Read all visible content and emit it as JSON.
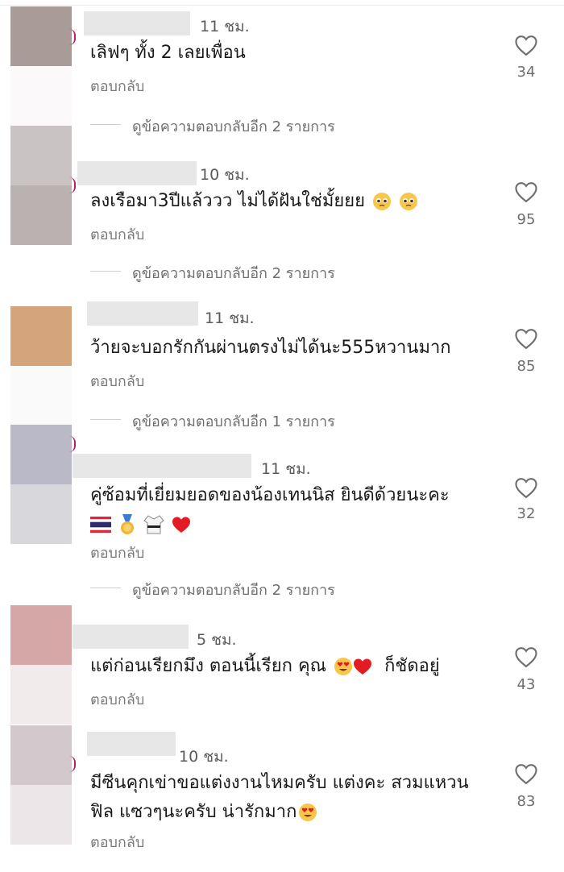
{
  "comments": [
    {
      "time": "11 ชม.",
      "text": "เลิฟๆ ทั้ง 2 เลยเพื่อน",
      "reply_label": "ตอบกลับ",
      "likes": "34",
      "more_replies": "ดูข้อความตอบกลับอีก 2 รายการ"
    },
    {
      "time": "10 ชม.",
      "text": "ลงเรือมา3ปีแล้ววว ไม่ได้ฝันใช่มั้ยยย",
      "reply_label": "ตอบกลับ",
      "likes": "95",
      "more_replies": "ดูข้อความตอบกลับอีก 2 รายการ"
    },
    {
      "time": "11 ชม.",
      "text": "ว้ายจะบอกรักกันผ่านตรงไม่ได้นะ555หวานมาก",
      "reply_label": "ตอบกลับ",
      "likes": "85",
      "more_replies": "ดูข้อความตอบกลับอีก 1 รายการ"
    },
    {
      "time": "11 ชม.",
      "text": "คู่ซ้อมที่เยี่ยมยอดของน้องเทนนิส ยินดีด้วยนะคะ",
      "reply_label": "ตอบกลับ",
      "likes": "32",
      "more_replies": "ดูข้อความตอบกลับอีก 2 รายการ"
    },
    {
      "time": "5 ชม.",
      "text": "แต่ก่อนเรียกมึง ตอนนี้เรียก คุณ",
      "text_suffix": "ก็ชัดอยู่",
      "reply_label": "ตอบกลับ",
      "likes": "43"
    },
    {
      "time": "10 ชม.",
      "text": "มีซีนคุกเข่าขอแต่งงานไหมครับ แต่งคะ สวมแหวน",
      "text_line2": "ฟิล แซวๆนะครับ น่ารักมาก",
      "reply_label": "ตอบกลับ",
      "likes": "83"
    }
  ],
  "colors": {
    "avatar_1": "#a99b97",
    "avatar_2": "#c3bdbb",
    "avatar_3": "#d4a47c",
    "avatar_4": "#b9b9c8",
    "avatar_5": "#d5a7a7",
    "avatar_6": "#d3c9cd",
    "ring": "#b1236c"
  },
  "icons": {
    "like": "heart-outline-icon",
    "emoji_2": "pleading-face-icon",
    "emoji_4": [
      "thailand-flag-icon",
      "gold-medal-icon",
      "martial-arts-uniform-icon",
      "red-heart-icon"
    ],
    "emoji_5": [
      "heart-eyes-face-icon",
      "red-heart-icon"
    ],
    "emoji_6": "heart-eyes-face-icon"
  }
}
